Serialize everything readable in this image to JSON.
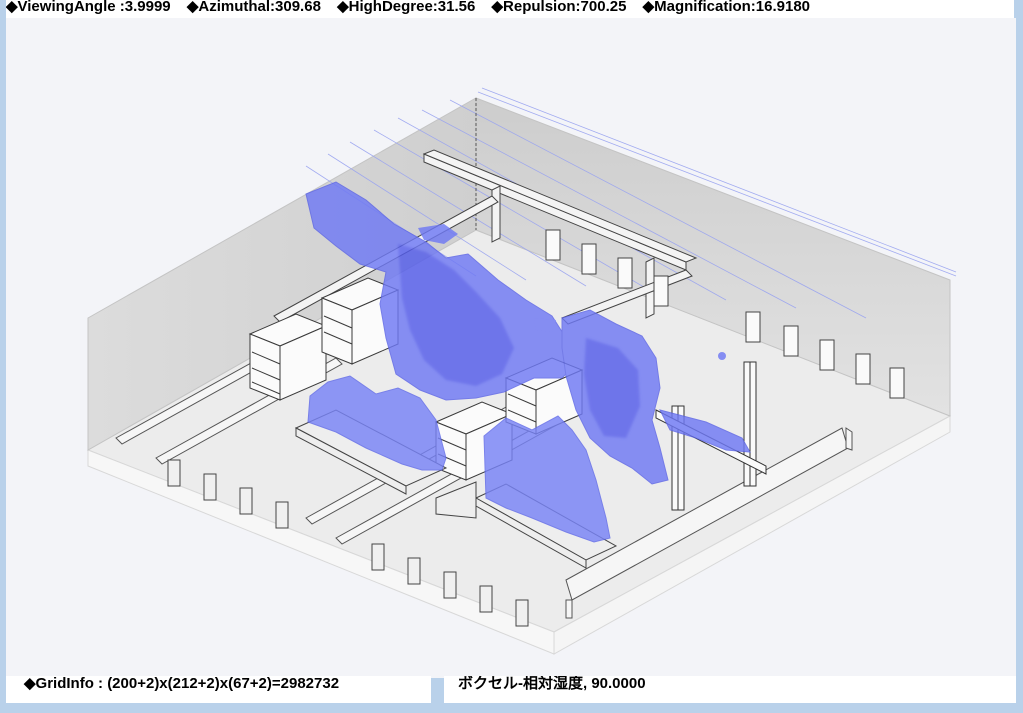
{
  "view_params": {
    "viewing_angle": "◆ViewingAngle :3.9999",
    "azimuthal": "◆Azimuthal:309.68",
    "high_degree": "◆HighDegree:31.56",
    "repulsion": "◆Repulsion:700.25",
    "magnification": "◆Magnification:16.9180"
  },
  "status": {
    "grid_info": "◆GridInfo : (200+2)x(212+2)x(67+2)=2982732",
    "voxel_info": "ボクセル-相対湿度, 90.0000"
  },
  "colors": {
    "background": "#f3f4f8",
    "window_frame": "#b9d1ea",
    "isosurface": "#6a75f0",
    "walls": "#d9d9d9",
    "floor": "#e8e8e8"
  }
}
